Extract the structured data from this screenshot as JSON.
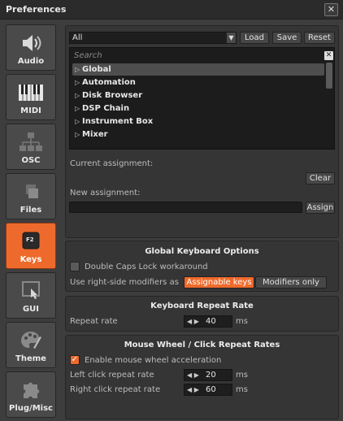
{
  "window": {
    "title": "Preferences",
    "close_label": "✕"
  },
  "sidebar": {
    "items": [
      {
        "label": "Audio",
        "icon": "speaker-icon",
        "active": false
      },
      {
        "label": "MIDI",
        "icon": "piano-keys-icon",
        "active": false
      },
      {
        "label": "OSC",
        "icon": "network-icon",
        "active": false
      },
      {
        "label": "Files",
        "icon": "files-icon",
        "active": false
      },
      {
        "label": "Keys",
        "icon": "function-key-icon",
        "active": true,
        "glyph": "F2"
      },
      {
        "label": "GUI",
        "icon": "gui-window-icon",
        "active": false
      },
      {
        "label": "Theme",
        "icon": "palette-icon",
        "active": false
      },
      {
        "label": "Plug/Misc",
        "icon": "puzzle-piece-icon",
        "active": false
      }
    ]
  },
  "keys": {
    "filter_value": "All",
    "load_label": "Load",
    "save_label": "Save",
    "reset_label": "Reset",
    "search_placeholder": "Search",
    "tree": [
      {
        "label": "Global",
        "selected": true
      },
      {
        "label": "Automation",
        "selected": false
      },
      {
        "label": "Disk Browser",
        "selected": false
      },
      {
        "label": "DSP Chain",
        "selected": false
      },
      {
        "label": "Instrument Box",
        "selected": false
      },
      {
        "label": "Mixer",
        "selected": false
      }
    ],
    "current_assignment_label": "Current assignment:",
    "current_assignment_value": "",
    "clear_label": "Clear",
    "new_assignment_label": "New assignment:",
    "new_assignment_value": "",
    "assign_label": "Assign"
  },
  "global_keyboard_options": {
    "title": "Global Keyboard Options",
    "double_caps_label": "Double Caps Lock workaround",
    "double_caps_checked": false,
    "modifiers_label": "Use right-side modifiers as",
    "modifiers_options": [
      "Assignable keys",
      "Modifiers only"
    ],
    "modifiers_selected": "Assignable keys"
  },
  "keyboard_repeat_rate": {
    "title": "Keyboard Repeat Rate",
    "repeat_rate_label": "Repeat rate",
    "repeat_rate_value": "40",
    "unit": "ms"
  },
  "mouse_wheel": {
    "title": "Mouse Wheel / Click Repeat Rates",
    "accel_label": "Enable mouse wheel acceleration",
    "accel_checked": true,
    "left_label": "Left click repeat rate",
    "left_value": "20",
    "right_label": "Right click repeat rate",
    "right_value": "60",
    "unit": "ms"
  },
  "colors": {
    "accent": "#ee6a2c",
    "background": "#3d3d3d",
    "panel": "#353535"
  }
}
